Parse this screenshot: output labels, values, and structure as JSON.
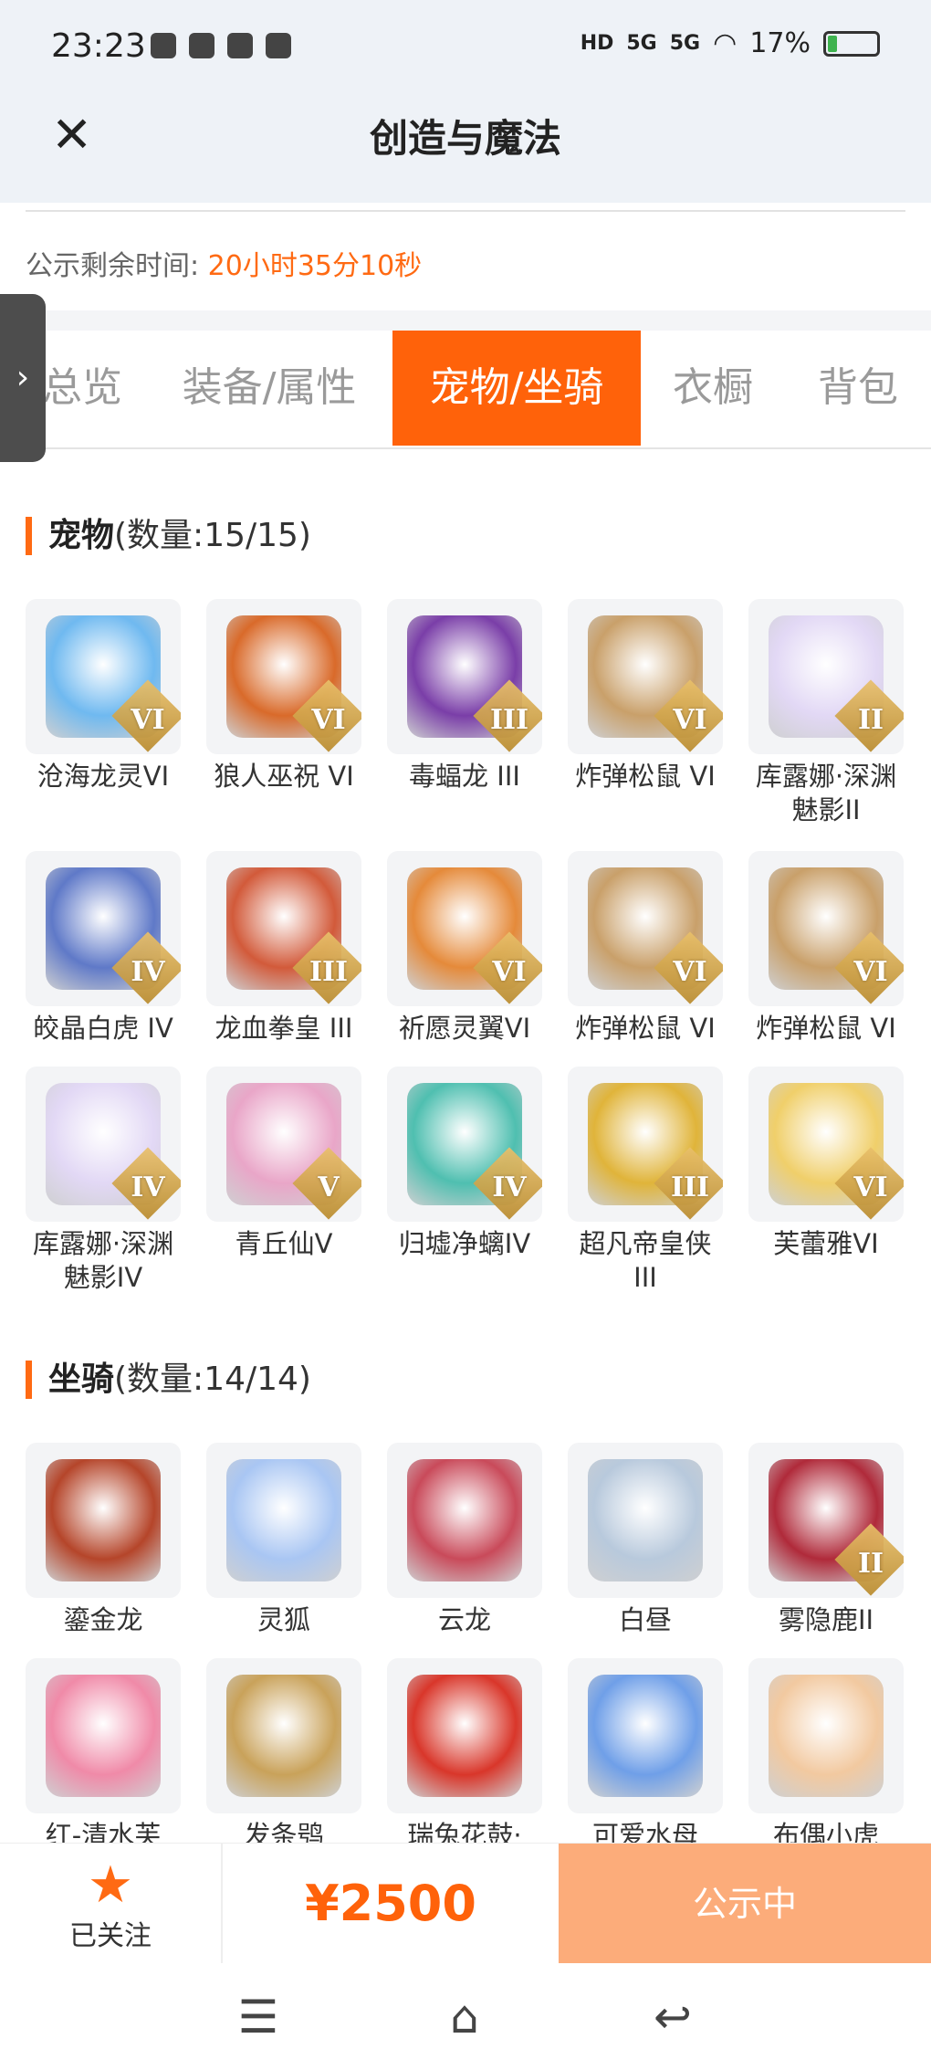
{
  "status": {
    "time": "23:23",
    "battery": "17%",
    "battery_level": 0.17,
    "signal1": "5G",
    "signal2": "5G",
    "hd": "HD"
  },
  "header": {
    "title": "创造与魔法"
  },
  "countdown": {
    "label": "公示剩余时间:",
    "value": "20小时35分10秒"
  },
  "tabs": [
    {
      "label": "总览",
      "active": false
    },
    {
      "label": "装备/属性",
      "active": false
    },
    {
      "label": "宠物/坐骑",
      "active": true
    },
    {
      "label": "衣橱",
      "active": false
    },
    {
      "label": "背包",
      "active": false
    }
  ],
  "pets": {
    "title": "宠物",
    "count": "(数量:15/15)",
    "items": [
      {
        "name": "沧海龙灵VI",
        "tier": "VI",
        "color": "#6fb9f0"
      },
      {
        "name": "狼人巫祝 VI",
        "tier": "VI",
        "color": "#d96a2a"
      },
      {
        "name": "毒蝠龙 III",
        "tier": "III",
        "color": "#7a3ea8"
      },
      {
        "name": "炸弹松鼠 VI",
        "tier": "VI",
        "color": "#c9a06a"
      },
      {
        "name": "库露娜·深渊魅影II",
        "tier": "II",
        "color": "#e2d8f5"
      },
      {
        "name": "皎晶白虎 IV",
        "tier": "IV",
        "color": "#5f79c8"
      },
      {
        "name": "龙血拳皇 III",
        "tier": "III",
        "color": "#d25a3a"
      },
      {
        "name": "祈愿灵翼VI",
        "tier": "VI",
        "color": "#e58a3a"
      },
      {
        "name": "炸弹松鼠 VI",
        "tier": "VI",
        "color": "#c9a06a"
      },
      {
        "name": "炸弹松鼠 VI",
        "tier": "VI",
        "color": "#c9a06a"
      },
      {
        "name": "库露娜·深渊魅影IV",
        "tier": "IV",
        "color": "#e2d8f5"
      },
      {
        "name": "青丘仙V",
        "tier": "V",
        "color": "#e9a6c8"
      },
      {
        "name": "归墟净螭IV",
        "tier": "IV",
        "color": "#4fbfb0"
      },
      {
        "name": "超凡帝皇侠III",
        "tier": "III",
        "color": "#e0b43a"
      },
      {
        "name": "芙蕾雅VI",
        "tier": "VI",
        "color": "#f0cf6a"
      }
    ]
  },
  "mounts": {
    "title": "坐骑",
    "count": "(数量:14/14)",
    "items": [
      {
        "name": "鎏金龙",
        "tier": "",
        "color": "#b5452a"
      },
      {
        "name": "灵狐",
        "tier": "",
        "color": "#a9c6f3"
      },
      {
        "name": "云龙",
        "tier": "",
        "color": "#c94a5a"
      },
      {
        "name": "白昼",
        "tier": "",
        "color": "#b8c9dc"
      },
      {
        "name": "雾隐鹿II",
        "tier": "II",
        "color": "#b02a3a"
      },
      {
        "name": "红-清水芙",
        "tier": "",
        "color": "#f08aa8"
      },
      {
        "name": "发条鸮",
        "tier": "",
        "color": "#c9a25a"
      },
      {
        "name": "瑞兔花鼓·",
        "tier": "",
        "color": "#d9362a"
      },
      {
        "name": "可爱水母",
        "tier": "",
        "color": "#6f9fe8"
      },
      {
        "name": "布偶小虎",
        "tier": "",
        "color": "#f2c9a0"
      }
    ]
  },
  "bottom": {
    "follow_label": "已关注",
    "price": "¥2500",
    "cta": "公示中"
  },
  "colors": {
    "accent": "#ff620a",
    "cta_bg": "#fcac7a"
  }
}
